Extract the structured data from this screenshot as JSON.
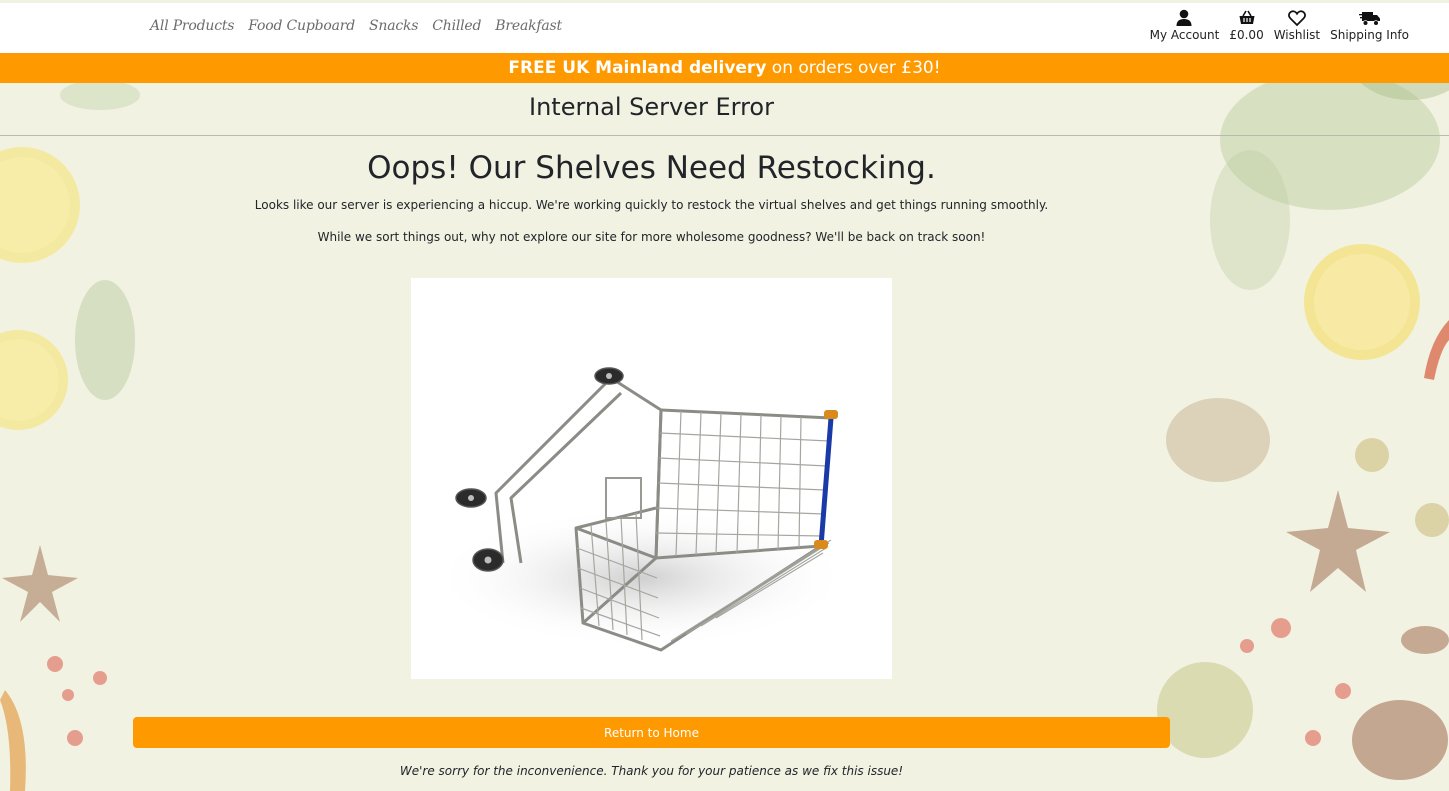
{
  "nav": {
    "links": [
      "All Products",
      "Food Cupboard",
      "Snacks",
      "Chilled",
      "Breakfast"
    ],
    "account_label": "My Account",
    "basket_total": "£0.00",
    "wishlist_label": "Wishlist",
    "shipping_label": "Shipping Info"
  },
  "banner": {
    "bold": "FREE UK Mainland delivery",
    "rest": " on orders over £30!"
  },
  "page": {
    "error_title": "Internal Server Error",
    "heading": "Oops! Our Shelves Need Restocking.",
    "paragraph1": "Looks like our server is experiencing a hiccup. We're working quickly to restock the virtual shelves and get things running smoothly.",
    "paragraph2": "While we sort things out, why not explore our site for more wholesome goodness? We'll be back on track soon!",
    "button_label": "Return to Home",
    "footer_note": "We're sorry for the inconvenience. Thank you for your patience as we fix this issue!"
  },
  "colors": {
    "accent": "#ff9900",
    "background": "#f2f2e3",
    "text": "#212529"
  },
  "icons": [
    "user-icon",
    "basket-icon",
    "heart-icon",
    "truck-icon"
  ]
}
